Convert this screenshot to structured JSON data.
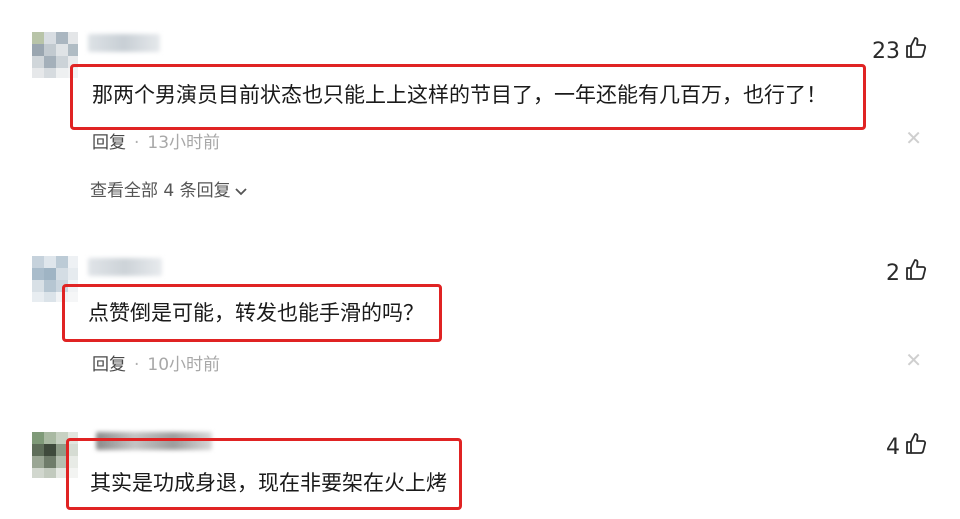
{
  "comments": [
    {
      "text": "那两个男演员目前状态也只能上上这样的节目了，一年还能有几百万，也行了！",
      "likes": "23",
      "reply_label": "回复",
      "separator": "·",
      "time": "13小时前",
      "view_all": "查看全部 4 条回复"
    },
    {
      "text": "点赞倒是可能，转发也能手滑的吗？",
      "likes": "2",
      "reply_label": "回复",
      "separator": "·",
      "time": "10小时前"
    },
    {
      "text": "其实是功成身退，现在非要架在火上烤",
      "likes": "4"
    }
  ],
  "colors": {
    "highlight": "#e02323",
    "time": "#a8a8a8",
    "text": "#1a1a1a"
  },
  "icons": {
    "like": "thumbs-up-icon",
    "close": "close-icon",
    "chevron": "chevron-down-icon"
  }
}
